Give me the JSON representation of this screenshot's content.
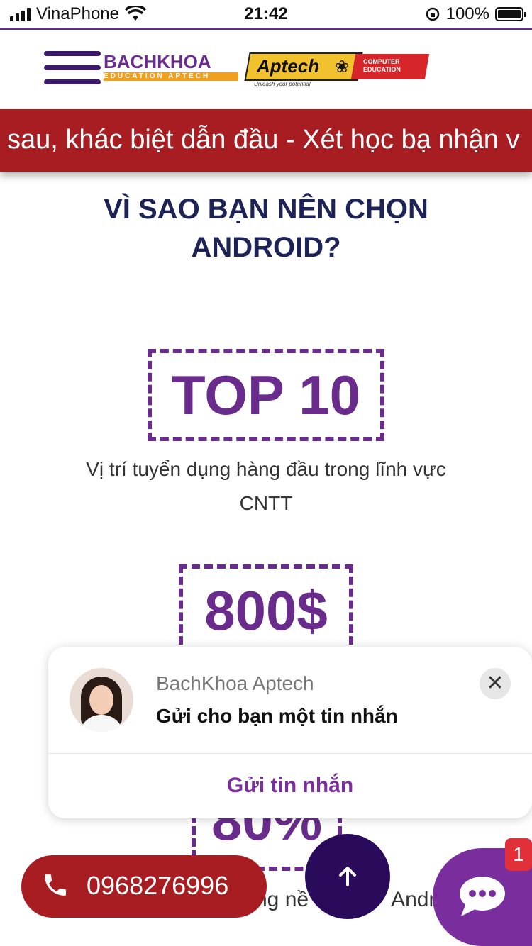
{
  "status_bar": {
    "carrier": "VinaPhone",
    "time": "21:42",
    "battery": "100%"
  },
  "header": {
    "logo_bachkhoa": "BACHKHOA",
    "logo_bachkhoa_sub": "EDUCATION APTECH",
    "logo_aptech": "Aptech",
    "logo_aptech_sub": "COMPUTER EDUCATION",
    "logo_aptech_tagline": "Unleash your potential"
  },
  "marquee": {
    "text": "sau, khác biệt dẫn đầu - Xét học bạ nhận v"
  },
  "section": {
    "heading_line1": "VÌ SAO BẠN NÊN CHỌN",
    "heading_line2": "ANDROID?"
  },
  "stats": [
    {
      "value": "TOP 10",
      "desc_line1": "Vị trí tuyển dụng hàng đầu trong lĩnh vực",
      "desc_line2": "CNTT"
    },
    {
      "value": "800$"
    },
    {
      "value": "80%",
      "desc_partial": "ng nề",
      "desc_partial_right": "Andro"
    }
  ],
  "chat_popup": {
    "sender": "BachKhoa Aptech",
    "message": "Gửi cho bạn một tin nhắn",
    "action": "Gửi tin nhắn"
  },
  "phone_button": {
    "number": "0968276996"
  },
  "chat_badge": "1",
  "colors": {
    "brand_purple": "#6a2c8c",
    "brand_red": "#a81d22",
    "heading_navy": "#1e2357"
  }
}
